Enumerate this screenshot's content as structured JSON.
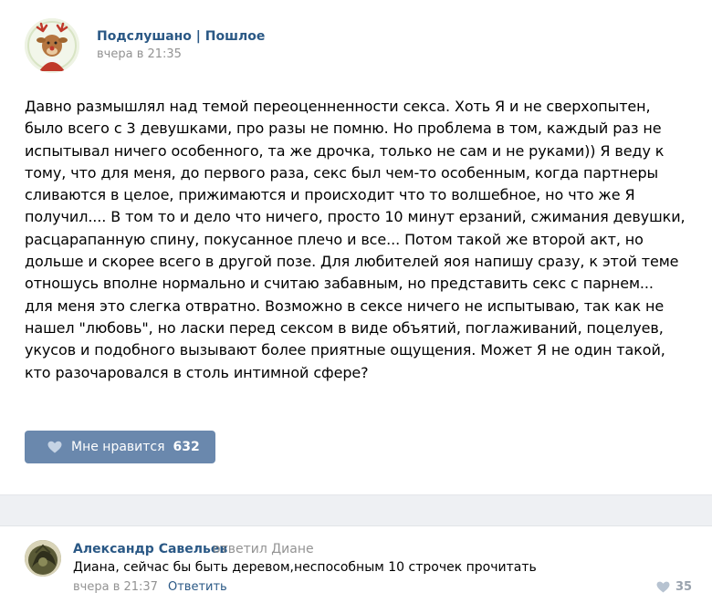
{
  "post": {
    "author": "Подслушано | Пошлое",
    "time": "вчера в 21:35",
    "text": "Давно размышлял над темой переоценненности секса. Хоть Я и не сверхопытен,\nбыло всего с 3 девушками, про разы не помню. Но проблема в том, каждый раз не\nиспытывал ничего особенного, та же дрочка, только не сам и не руками)) Я веду к\nтому, что для меня, до первого раза, секс был чем-то особенным, когда партнеры\nсливаются в целое, прижимаются и происходит что то волшебное, но что же Я\nполучил.... В том то и дело что ничего, просто 10 минут ерзаний, сжимания девушки,\nрасцарапанную спину, покусанное плечо и все... Потом такой же второй акт, но\nдольше и скорее всего в другой позе. Для любителей яоя напишу сразу, к этой теме\nотношусь вполне нормально и считаю забавным, но представить секс с парнем...\nдля меня это слегка отвратно. Возможно в сексе ничего не испытываю, так как не\nнашел \"любовь\", но ласки перед сексом в виде объятий, поглаживаний, поцелуев,\nукусов и подобного вызывают более приятные ощущения. Может Я не один такой,\nкто разочаровался в столь интимной сфере?",
    "like_label": "Мне нравится",
    "like_count": "632",
    "avatar_icon": "reindeer-avatar-icon"
  },
  "comment": {
    "author": "Александр Савельев",
    "replied_to": "ответил Диане",
    "text": "Диана, сейчас бы быть деревом,неспособным 10 строчек прочитать",
    "time": "вчера в 21:37",
    "reply_label": "Ответить",
    "like_count": "35",
    "avatar_icon": "user-photo-avatar-icon"
  },
  "colors": {
    "link": "#2a5885",
    "button": "#6a88ad",
    "muted": "#939393",
    "separator": "#eef0f3"
  }
}
